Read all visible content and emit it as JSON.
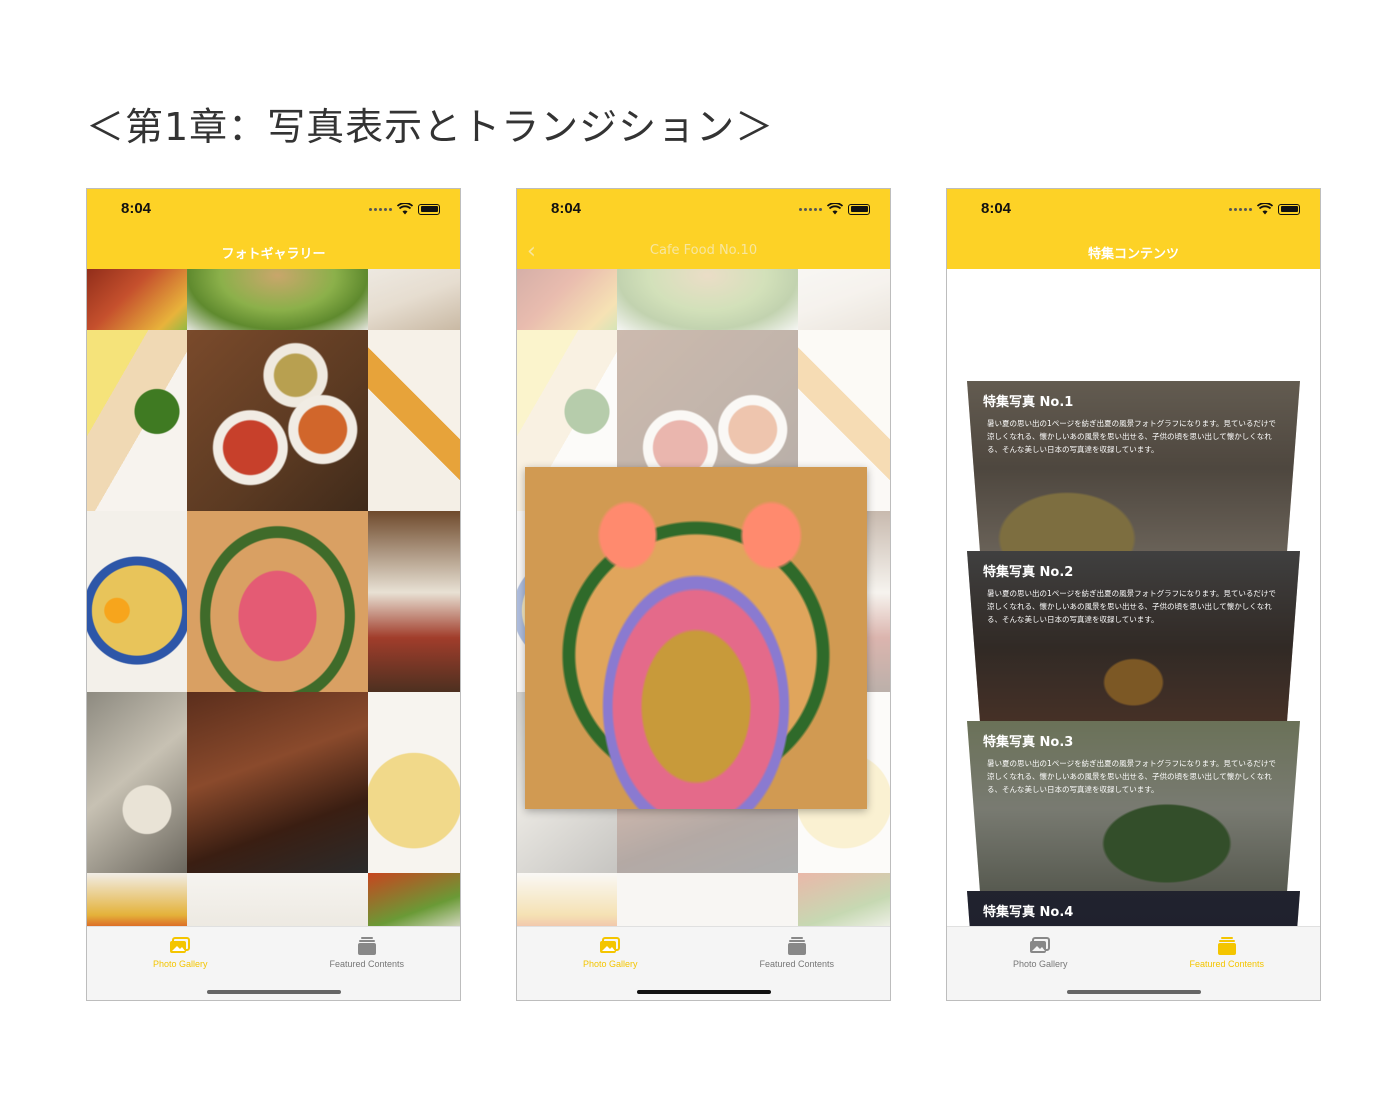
{
  "page": {
    "title": "＜第1章：写真表示とトランジション＞"
  },
  "phones": [
    {
      "status_time": "8:04",
      "nav_title": "フォトギャラリー",
      "tabs": [
        {
          "label": "Photo Gallery",
          "icon": "photo-gallery-icon",
          "active": true
        },
        {
          "label": "Featured Contents",
          "icon": "featured-contents-icon",
          "active": false
        }
      ]
    },
    {
      "status_time": "8:04",
      "nav_title": "Cafe Food No.10",
      "back_icon": "back-chevron-icon",
      "tabs": [
        {
          "label": "Photo Gallery",
          "icon": "photo-gallery-icon",
          "active": true
        },
        {
          "label": "Featured Contents",
          "icon": "featured-contents-icon",
          "active": false
        }
      ]
    },
    {
      "status_time": "8:04",
      "nav_title": "特集コンテンツ",
      "cards": [
        {
          "title": "特集写真 No.1",
          "desc": "暑い夏の思い出の1ページを紡ぎ出夏の風景フォトグラフになります。見ているだけで涼しくなれる、懐かしいあの風景を思い出せる、子供の頃を思い出して懐かしくなれる、そんな美しい日本の写真達を収録しています。"
        },
        {
          "title": "特集写真 No.2",
          "desc": "暑い夏の思い出の1ページを紡ぎ出夏の風景フォトグラフになります。見ているだけで涼しくなれる、懐かしいあの風景を思い出せる、子供の頃を思い出して懐かしくなれる、そんな美しい日本の写真達を収録しています。"
        },
        {
          "title": "特集写真 No.3",
          "desc": "暑い夏の思い出の1ページを紡ぎ出夏の風景フォトグラフになります。見ているだけで涼しくなれる、懐かしいあの風景を思い出せる、子供の頃を思い出して懐かしくなれる、そんな美しい日本の写真達を収録しています。"
        },
        {
          "title": "特集写真 No.4",
          "desc": ""
        }
      ],
      "tabs": [
        {
          "label": "Photo Gallery",
          "icon": "photo-gallery-icon",
          "active": false
        },
        {
          "label": "Featured Contents",
          "icon": "featured-contents-icon",
          "active": true
        }
      ]
    }
  ],
  "colors": {
    "accent": "#fdd226",
    "tab_active": "#f4c500",
    "tab_inactive": "#777777"
  }
}
